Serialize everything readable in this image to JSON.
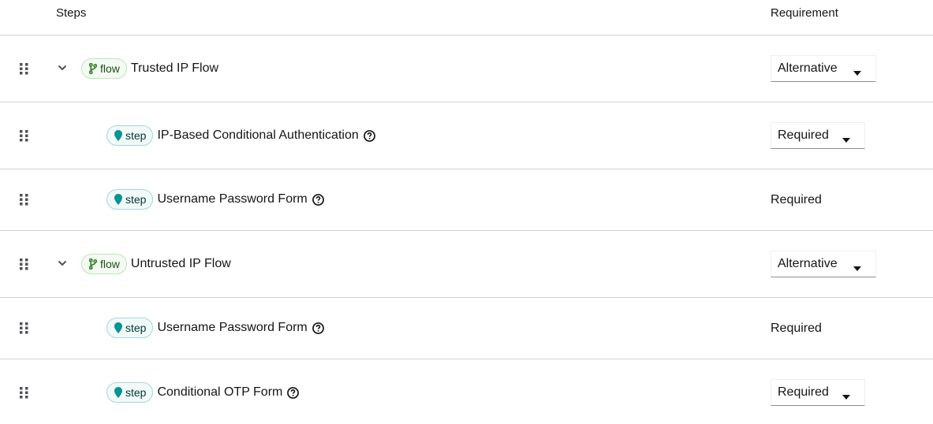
{
  "header": {
    "steps_label": "Steps",
    "requirement_label": "Requirement"
  },
  "rows": [
    {
      "kind": "flow",
      "badge": "flow",
      "name": "Trusted IP Flow",
      "expandable": true,
      "help": false,
      "requirement": "Alternative",
      "requirement_editable": true
    },
    {
      "kind": "step",
      "badge": "step",
      "name": "IP-Based Conditional Authentication",
      "expandable": false,
      "help": true,
      "requirement": "Required",
      "requirement_editable": true
    },
    {
      "kind": "step",
      "badge": "step",
      "name": "Username Password Form",
      "expandable": false,
      "help": true,
      "requirement": "Required",
      "requirement_editable": false
    },
    {
      "kind": "flow",
      "badge": "flow",
      "name": "Untrusted IP Flow",
      "expandable": true,
      "help": false,
      "requirement": "Alternative",
      "requirement_editable": true
    },
    {
      "kind": "step",
      "badge": "step",
      "name": "Username Password Form",
      "expandable": false,
      "help": true,
      "requirement": "Required",
      "requirement_editable": false
    },
    {
      "kind": "step",
      "badge": "step",
      "name": "Conditional OTP Form",
      "expandable": false,
      "help": true,
      "requirement": "Required",
      "requirement_editable": true
    }
  ],
  "icons": {
    "drag": "grip-vertical-icon",
    "toggle": "chevron-down-icon",
    "flow": "code-branch-icon",
    "step": "map-marker-icon",
    "help": "question-circle-icon",
    "caret": "caret-down-icon"
  },
  "colors": {
    "flow_badge_bg": "#f3faf2",
    "flow_badge_border": "#bde5b8",
    "flow_icon": "#3e8635",
    "step_badge_bg": "#f2f9f9",
    "step_badge_border": "#a2d9d9",
    "step_icon": "#009596",
    "divider": "#d2d2d2"
  }
}
